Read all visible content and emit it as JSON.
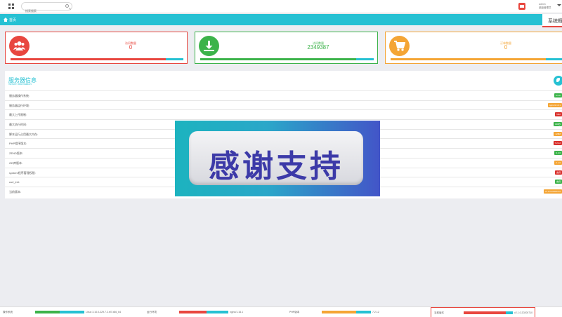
{
  "header": {
    "search": {
      "placeholder": "搜索搜索",
      "value": ""
    },
    "user": {
      "name": "admin",
      "role": "超级管理员"
    }
  },
  "tabs": {
    "home": "首页",
    "current": "系统概览"
  },
  "stats": [
    {
      "label": "访问数量",
      "value": "0",
      "color": "#e8473f",
      "icon": "users-icon",
      "progress": 0.9
    },
    {
      "label": "访问数量",
      "value": "2349387",
      "color": "#3cb34a",
      "icon": "download-icon",
      "progress": 0.9
    },
    {
      "label": "订单数量",
      "value": "0",
      "color": "#f4a535",
      "icon": "shopping-cart-icon",
      "progress": 0.9
    }
  ],
  "server": {
    "title": "服务器信息",
    "subtitle": "Server information",
    "rows": [
      {
        "label": "服务器操作系统:",
        "value": "Linux",
        "color": "#3cb34a"
      },
      {
        "label": "服务器运行环境:",
        "value": "nginx/1.16.1",
        "color": "#f4a535"
      },
      {
        "label": "最大上传限制:",
        "value": "50M",
        "color": "#d9302c"
      },
      {
        "label": "最大执行时间:",
        "value": "300秒",
        "color": "#3cb34a"
      },
      {
        "label": "脚本运行占用最大内存:",
        "value": "128M",
        "color": "#f4a535"
      },
      {
        "label": "PHP程序版本:",
        "value": "7.2.12",
        "color": "#d9302c"
      },
      {
        "label": "ZEND版本:",
        "value": "3.2.0",
        "color": "#3cb34a"
      },
      {
        "label": "GD库版本:",
        "value": "2.1.0",
        "color": "#f4a535"
      },
      {
        "label": "system程序管理权限:",
        "value": "支持",
        "color": "#d9302c"
      },
      {
        "label": "curl_init:",
        "value": "支持",
        "color": "#3cb34a"
      },
      {
        "label": "当前版本:",
        "value": "v2.1.0.20200710",
        "color": "#f4a535"
      }
    ]
  },
  "banner": {
    "text": "感谢支持"
  },
  "footer": [
    {
      "label": "操作系统",
      "value": "Linux 3.10.0-229.7.2.el7.x86_64",
      "colors": [
        "#3cb34a",
        "#26c1d3"
      ]
    },
    {
      "label": "运行环境",
      "value": "nginx/1.16.1",
      "colors": [
        "#e8473f",
        "#26c1d3"
      ]
    },
    {
      "label": "PHP版本",
      "value": "7.2.12",
      "colors": [
        "#f4a535",
        "#26c1d3"
      ]
    },
    {
      "label": "当前版本",
      "value": "v2.1.0.20200710",
      "colors": [
        "#e8473f",
        "#26c1d3"
      ]
    }
  ]
}
